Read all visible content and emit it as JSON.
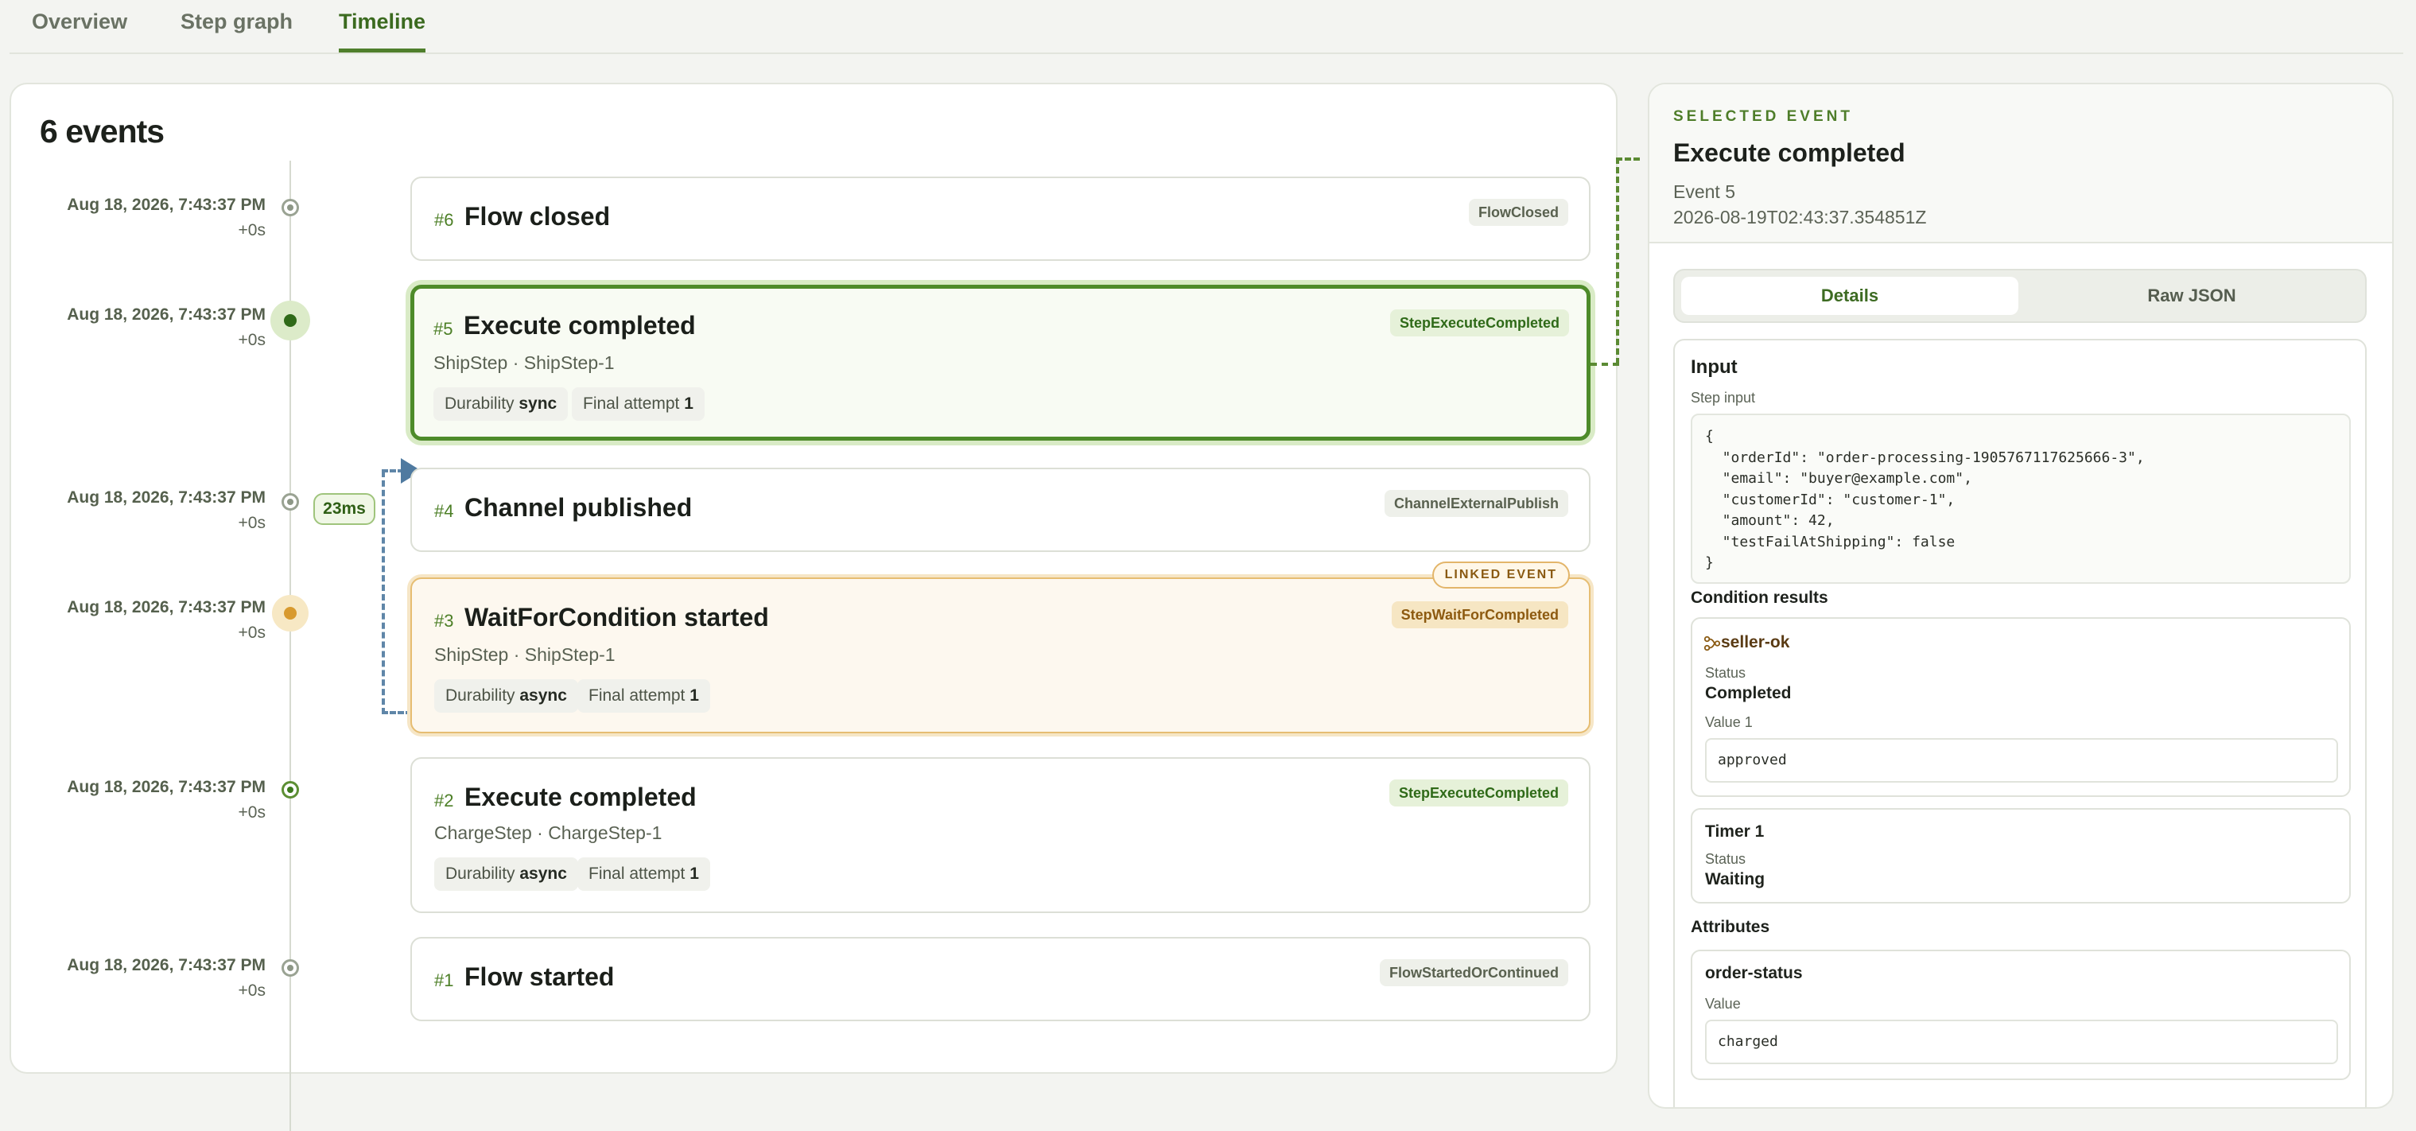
{
  "tabs": [
    {
      "label": "Overview"
    },
    {
      "label": "Step graph"
    },
    {
      "label": "Timeline"
    }
  ],
  "timeline": {
    "heading": "6 events",
    "gap_label": "23ms",
    "events": [
      {
        "time": "Aug 18, 2026, 7:43:37 PM",
        "offset": "+0s",
        "num": "#6",
        "title": "Flow closed",
        "type": "FlowClosed"
      },
      {
        "time": "Aug 18, 2026, 7:43:37 PM",
        "offset": "+0s",
        "num": "#5",
        "title": "Execute completed",
        "type": "StepExecuteCompleted",
        "sub": "ShipStep · ShipStep-1",
        "durability_label": "Durability",
        "durability": "sync",
        "attempt_label": "Final attempt",
        "attempt": "1"
      },
      {
        "time": "Aug 18, 2026, 7:43:37 PM",
        "offset": "+0s",
        "num": "#4",
        "title": "Channel published",
        "type": "ChannelExternalPublish"
      },
      {
        "time": "Aug 18, 2026, 7:43:37 PM",
        "offset": "+0s",
        "num": "#3",
        "title": "WaitForCondition started",
        "type": "StepWaitForCompleted",
        "sub": "ShipStep · ShipStep-1",
        "durability_label": "Durability",
        "durability": "async",
        "attempt_label": "Final attempt",
        "attempt": "1",
        "linked_label": "LINKED EVENT"
      },
      {
        "time": "Aug 18, 2026, 7:43:37 PM",
        "offset": "+0s",
        "num": "#2",
        "title": "Execute completed",
        "type": "StepExecuteCompleted",
        "sub": "ChargeStep · ChargeStep-1",
        "durability_label": "Durability",
        "durability": "async",
        "attempt_label": "Final attempt",
        "attempt": "1"
      },
      {
        "time": "Aug 18, 2026, 7:43:37 PM",
        "offset": "+0s",
        "num": "#1",
        "title": "Flow started",
        "type": "FlowStartedOrContinued"
      }
    ]
  },
  "selected": {
    "label": "SELECTED EVENT",
    "title": "Execute completed",
    "event_id": "Event 5",
    "timestamp": "2026-08-19T02:43:37.354851Z",
    "tabs": {
      "details": "Details",
      "raw": "Raw JSON"
    },
    "input": {
      "title": "Input",
      "sub": "Step input",
      "json": "{\n  \"orderId\": \"order-processing-1905767117625666-3\",\n  \"email\": \"buyer@example.com\",\n  \"customerId\": \"customer-1\",\n  \"amount\": 42,\n  \"testFailAtShipping\": false\n}"
    },
    "conditions": {
      "title": "Condition results",
      "items": [
        {
          "name": "seller-ok",
          "status_label": "Status",
          "status": "Completed",
          "value_label": "Value 1",
          "value": "approved"
        },
        {
          "name": "Timer 1",
          "status_label": "Status",
          "status": "Waiting"
        }
      ]
    },
    "attributes": {
      "title": "Attributes",
      "items": [
        {
          "name": "order-status",
          "value_label": "Value",
          "value": "charged"
        }
      ]
    }
  },
  "colors": {
    "accent": "#4f7f2c",
    "linked": "#e6bd72",
    "connector": "#5f86a8"
  }
}
